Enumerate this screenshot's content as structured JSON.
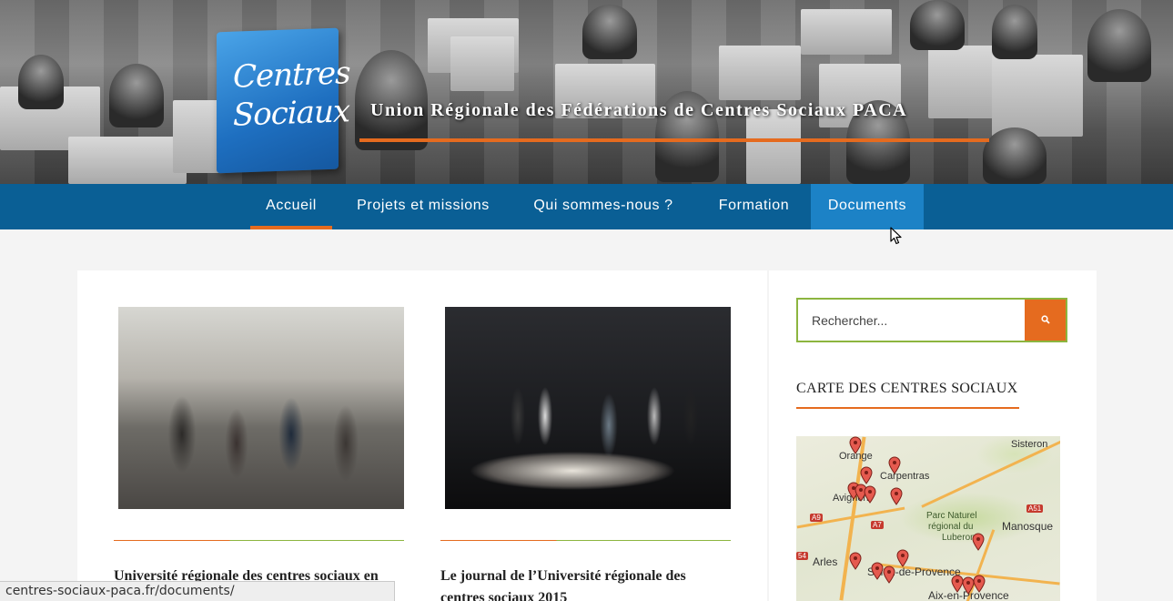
{
  "header": {
    "logo_line1": "Centres",
    "logo_line2": "Sociaux",
    "site_title": "Union Régionale des Fédérations de Centres Sociaux PACA"
  },
  "nav": {
    "items": [
      {
        "label": "Accueil",
        "state": "active"
      },
      {
        "label": "Projets et missions",
        "state": "normal"
      },
      {
        "label": "Qui sommes-nous ?",
        "state": "normal"
      },
      {
        "label": "Formation",
        "state": "normal"
      },
      {
        "label": "Documents",
        "state": "hover"
      }
    ]
  },
  "posts": [
    {
      "title": "Université régionale des centres sociaux en",
      "image": "crowd-photo"
    },
    {
      "title": "Le journal de l’Université régionale des centres sociaux 2015",
      "image": "stage-dance-photo"
    }
  ],
  "sidebar": {
    "search_placeholder": "Rechercher...",
    "search_button_icon": "search-icon",
    "map_widget_title": "CARTE DES CENTRES SOCIAUX",
    "map_labels": {
      "orange": "Orange",
      "sisteron": "Sisteron",
      "carpentras": "Carpentras",
      "avignon": "Avignon",
      "a51": "A51",
      "a9": "A9",
      "a7": "A7",
      "parc1": "Parc Naturel",
      "parc2": "régional du",
      "parc3": "Luberon",
      "manosque": "Manosque",
      "a54": "54",
      "arles": "Arles",
      "salon": "Salon-de-Provence",
      "aix": "Aix-en-Provence"
    }
  },
  "statusbar": {
    "url": "centres-sociaux-paca.fr/documents/"
  },
  "colors": {
    "nav_bg": "#0a5f95",
    "nav_hover": "#1c82c6",
    "accent_orange": "#e56b1f",
    "accent_green": "#8cb53f"
  }
}
